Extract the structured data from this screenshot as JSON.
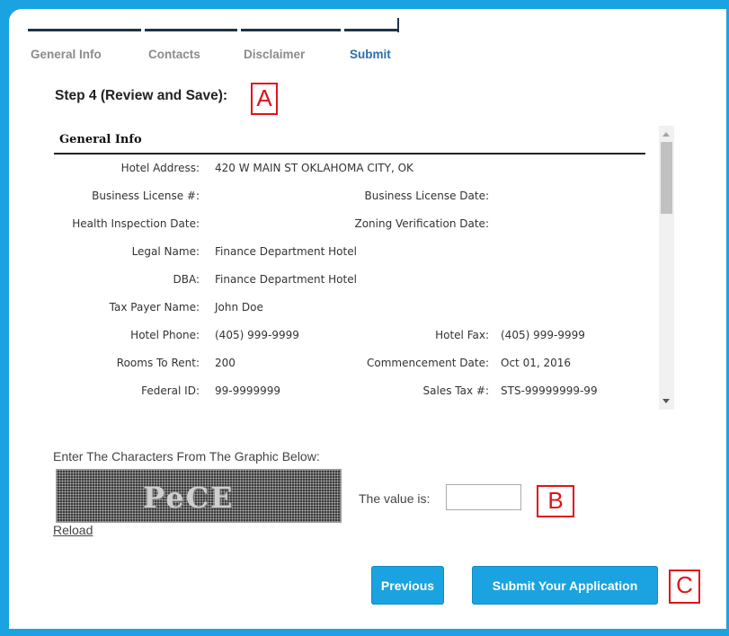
{
  "tabs": [
    {
      "label": "General Info",
      "active": false
    },
    {
      "label": "Contacts",
      "active": false
    },
    {
      "label": "Disclaimer",
      "active": false
    },
    {
      "label": "Submit",
      "active": true
    }
  ],
  "step_title": "Step 4 (Review and Save):",
  "markers": {
    "a": "A",
    "b": "B",
    "c": "C"
  },
  "review": {
    "section_title": "General Info",
    "rows": [
      {
        "label1": "Hotel Address:",
        "value1": "420 W MAIN ST OKLAHOMA CITY, OK",
        "label2": "",
        "value2": ""
      },
      {
        "label1": "Business License #:",
        "value1": "",
        "label2": "Business License Date:",
        "value2": ""
      },
      {
        "label1": "Health Inspection Date:",
        "value1": "",
        "label2": "Zoning Verification Date:",
        "value2": ""
      },
      {
        "label1": "Legal Name:",
        "value1": "Finance Department Hotel",
        "label2": "",
        "value2": ""
      },
      {
        "label1": "DBA:",
        "value1": "Finance Department Hotel",
        "label2": "",
        "value2": ""
      },
      {
        "label1": "Tax Payer Name:",
        "value1": "John Doe",
        "label2": "",
        "value2": ""
      },
      {
        "label1": "Hotel Phone:",
        "value1": "(405) 999-9999",
        "label2": "Hotel Fax:",
        "value2": "(405) 999-9999"
      },
      {
        "label1": "Rooms To Rent:",
        "value1": "200",
        "label2": "Commencement Date:",
        "value2": "Oct 01, 2016"
      },
      {
        "label1": "Federal ID:",
        "value1": "99-9999999",
        "label2": "Sales Tax #:",
        "value2": "STS-99999999-99"
      }
    ]
  },
  "captcha": {
    "instruction": "Enter The Characters From The Graphic Below:",
    "graphic_text": "PeCE",
    "reload": "Reload",
    "value_label": "The value is:",
    "value": ""
  },
  "buttons": {
    "previous": "Previous",
    "submit": "Submit Your Application"
  },
  "colors": {
    "accent": "#1aa3e0",
    "active_tab": "#2a6fa8",
    "marker": "#e0131a"
  }
}
